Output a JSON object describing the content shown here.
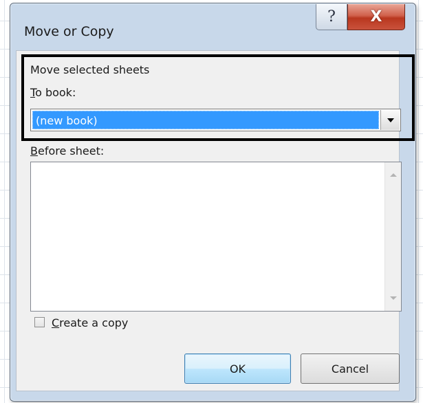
{
  "dialog": {
    "title": "Move or Copy",
    "help_glyph": "?",
    "close_glyph": "X"
  },
  "move_section": {
    "heading": "Move selected sheets",
    "to_book_label_underlined": "T",
    "to_book_label_rest": "o book:",
    "to_book_value": "(new book)"
  },
  "before_sheet": {
    "label_underlined": "B",
    "label_rest": "efore sheet:",
    "items": []
  },
  "create_copy": {
    "label_underlined": "C",
    "label_rest": "reate a copy",
    "checked": false
  },
  "buttons": {
    "ok_label": "OK",
    "cancel_label": "Cancel"
  },
  "colors": {
    "selection": "#3399ff",
    "close_button": "#c9523c",
    "highlight_border": "#000000"
  }
}
